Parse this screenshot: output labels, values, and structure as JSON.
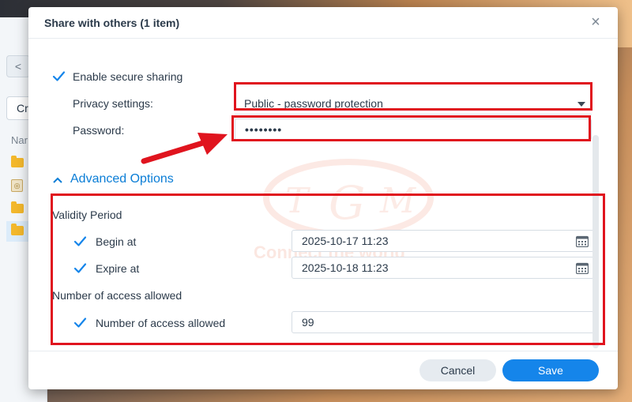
{
  "background": {
    "file_browser": {
      "back_glyph": "<",
      "create_label": "Cr",
      "name_header": "Nar"
    }
  },
  "dialog": {
    "title": "Share with others (1 item)",
    "close_glyph": "×",
    "enable_secure_sharing": {
      "label": "Enable secure sharing",
      "checked": true
    },
    "privacy_settings": {
      "label": "Privacy settings:",
      "value": "Public - password protection"
    },
    "password": {
      "label": "Password:",
      "value": "••••••••"
    },
    "advanced_options": {
      "label": "Advanced Options",
      "expanded": true
    },
    "validity_period": {
      "label": "Validity Period",
      "begin_at": {
        "label": "Begin at",
        "checked": true,
        "value": "2025-10-17 11:23"
      },
      "expire_at": {
        "label": "Expire at",
        "checked": true,
        "value": "2025-10-18 11:23"
      }
    },
    "access_limit": {
      "section_label": "Number of access allowed",
      "checkbox_label": "Number of access allowed",
      "checked": true,
      "value": "99"
    },
    "buttons": {
      "cancel": "Cancel",
      "save": "Save"
    }
  },
  "watermark": {
    "text": "Connect the world",
    "letters": [
      "T",
      "G",
      "M"
    ]
  },
  "colors": {
    "accent": "#1585ea",
    "link": "#0a7dd6",
    "annotation_red": "#e0141e",
    "checkbox_blue": "#1585ea"
  },
  "icons": {
    "close": "close-icon",
    "dropdown": "chevron-down-icon",
    "advanced": "chevron-up-icon",
    "calendar": "calendar-icon",
    "checkbox": "checkmark-icon",
    "arrow": "annotation-arrow-icon"
  }
}
